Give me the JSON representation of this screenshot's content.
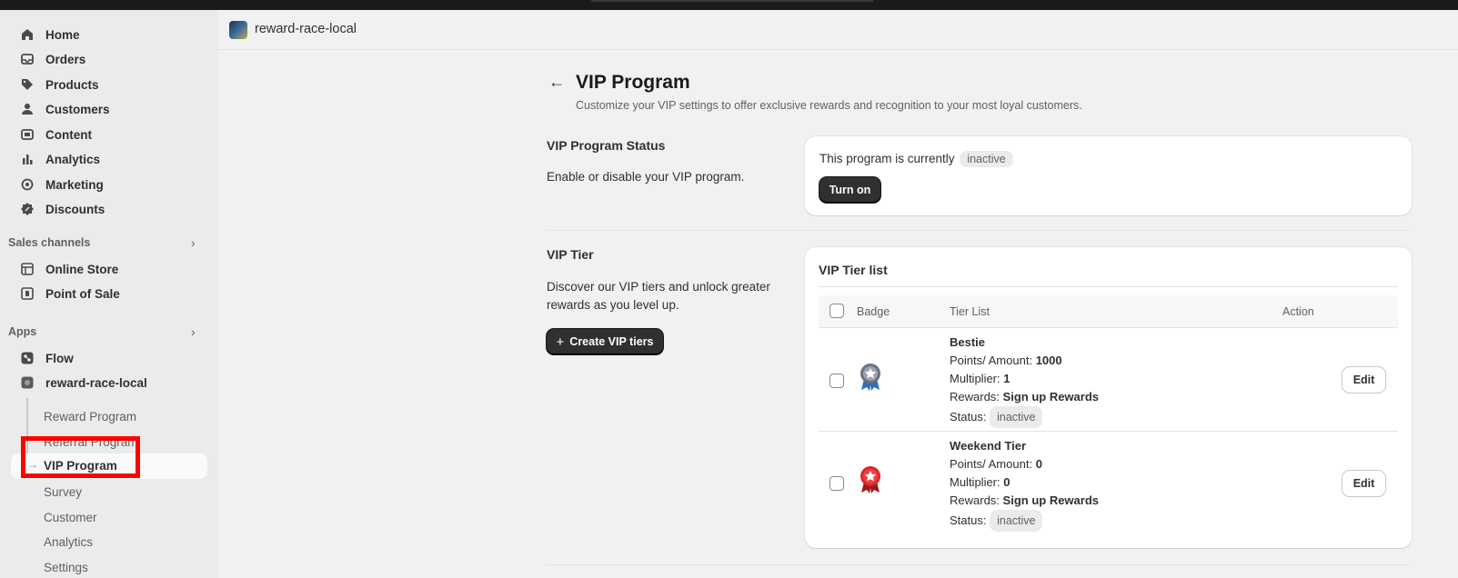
{
  "sidebar": {
    "main_nav": [
      {
        "label": "Home",
        "icon": "home-icon"
      },
      {
        "label": "Orders",
        "icon": "inbox-icon"
      },
      {
        "label": "Products",
        "icon": "tag-icon"
      },
      {
        "label": "Customers",
        "icon": "person-icon"
      },
      {
        "label": "Content",
        "icon": "content-icon"
      },
      {
        "label": "Analytics",
        "icon": "bar-chart-icon"
      },
      {
        "label": "Marketing",
        "icon": "target-icon"
      },
      {
        "label": "Discounts",
        "icon": "discount-icon"
      }
    ],
    "sales_channels_label": "Sales channels",
    "sales_channels": [
      {
        "label": "Online Store",
        "icon": "store-icon"
      },
      {
        "label": "Point of Sale",
        "icon": "pos-icon"
      }
    ],
    "apps_label": "Apps",
    "apps": [
      {
        "label": "Flow",
        "icon": "flow-icon"
      },
      {
        "label": "reward-race-local",
        "icon": "app-icon"
      }
    ],
    "app_sub_items": [
      "Reward Program",
      "Referral Program",
      "VIP Program",
      "Survey",
      "Customer",
      "Analytics",
      "Settings"
    ],
    "active_sub": "VIP Program"
  },
  "header": {
    "app_name": "reward-race-local"
  },
  "page": {
    "title": "VIP Program",
    "subtitle": "Customize your VIP settings to offer exclusive rewards and recognition to your most loyal customers."
  },
  "status_section": {
    "title": "VIP Program Status",
    "description": "Enable or disable your VIP program.",
    "status_text": "This program is currently",
    "status_badge": "inactive",
    "button": "Turn on"
  },
  "tier_section": {
    "title": "VIP Tier",
    "description": "Discover our VIP tiers and unlock greater rewards as you level up.",
    "button": "Create VIP tiers",
    "list_title": "VIP Tier list",
    "columns": [
      "Badge",
      "Tier List",
      "Action"
    ],
    "rows": [
      {
        "name": "Bestie",
        "points_label": "Points/ Amount:",
        "points": "1000",
        "multiplier_label": "Multiplier:",
        "multiplier": "1",
        "rewards_label": "Rewards:",
        "rewards": "Sign up Rewards",
        "status_label": "Status:",
        "status": "inactive",
        "action": "Edit",
        "badge_color": "#6b7280"
      },
      {
        "name": "Weekend Tier",
        "points_label": "Points/ Amount:",
        "points": "0",
        "multiplier_label": "Multiplier:",
        "multiplier": "0",
        "rewards_label": "Rewards:",
        "rewards": "Sign up Rewards",
        "status_label": "Status:",
        "status": "inactive",
        "action": "Edit",
        "badge_color": "#dc2626"
      }
    ]
  }
}
